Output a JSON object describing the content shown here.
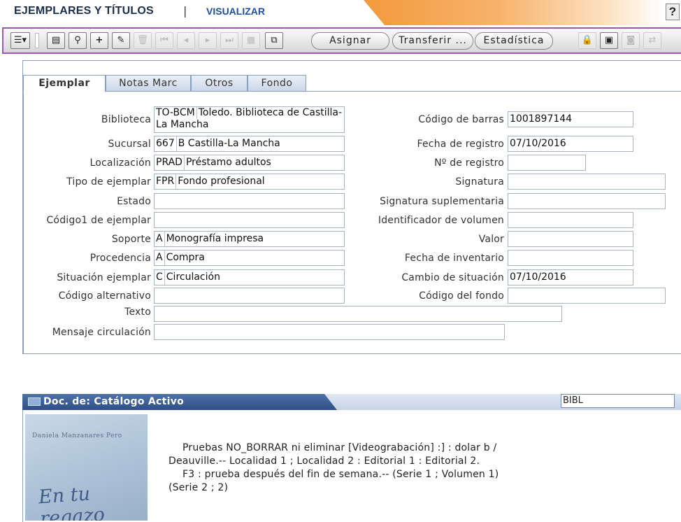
{
  "header": {
    "title": "EJEMPLARES Y TÍTULOS",
    "separator": "|",
    "view": "VISUALIZAR",
    "help": "?"
  },
  "toolbar": {
    "assign_label": "Asignar",
    "transfer_label": "Transferir ...",
    "stats_label": "Estadística"
  },
  "tabs": [
    "Ejemplar",
    "Notas Marc",
    "Otros",
    "Fondo"
  ],
  "form": {
    "left": [
      {
        "label": "Biblioteca",
        "code": "TO-BCM",
        "value": "Toledo. Biblioteca de Castilla-La Mancha"
      },
      {
        "label": "Sucursal",
        "code": "667",
        "value": "B Castilla-La Mancha"
      },
      {
        "label": "Localización",
        "code": "PRAD",
        "value": "Préstamo adultos"
      },
      {
        "label": "Tipo de ejemplar",
        "code": "FPR",
        "value": "Fondo profesional"
      },
      {
        "label": "Estado",
        "code": "",
        "value": ""
      },
      {
        "label": "Código1 de ejemplar",
        "code": "",
        "value": ""
      },
      {
        "label": "Soporte",
        "code": "A",
        "value": "Monografía impresa"
      },
      {
        "label": "Procedencia",
        "code": "A",
        "value": "Compra"
      },
      {
        "label": "Situación ejemplar",
        "code": "C",
        "value": "Circulación"
      },
      {
        "label": "Código alternativo",
        "code": "",
        "value": ""
      },
      {
        "label": "Texto",
        "code": "",
        "value": ""
      },
      {
        "label": "Mensaje circulación",
        "code": "",
        "value": ""
      }
    ],
    "right": [
      {
        "label": "Código de barras",
        "value": "1001897144"
      },
      {
        "label": "Fecha de registro",
        "value": "07/10/2016"
      },
      {
        "label": "Nº de registro",
        "value": ""
      },
      {
        "label": "Signatura",
        "value": ""
      },
      {
        "label": "Signatura suplementaria",
        "value": ""
      },
      {
        "label": "Identificador de volumen",
        "value": ""
      },
      {
        "label": "Valor",
        "value": ""
      },
      {
        "label": "Fecha de inventario",
        "value": ""
      },
      {
        "label": "Cambio de situación",
        "value": "07/10/2016"
      },
      {
        "label": "Código del fondo",
        "value": ""
      }
    ]
  },
  "doc": {
    "title": "Doc. de: Catálogo Activo",
    "search_value": "BIBL",
    "cover_author": "Daniela Manzanares Pero",
    "cover_title": "En tu regazo",
    "line1": "Pruebas NO_BORRAR ni eliminar [Videograbación] :] : dolar b / Deauville.-- Localidad 1 ; Localidad 2 : Editorial 1 : Editorial 2.",
    "line2": "F3 : prueba después del fin de semana.-- (Serie 1 ; Volumen 1)(Serie 2 ; 2)"
  }
}
